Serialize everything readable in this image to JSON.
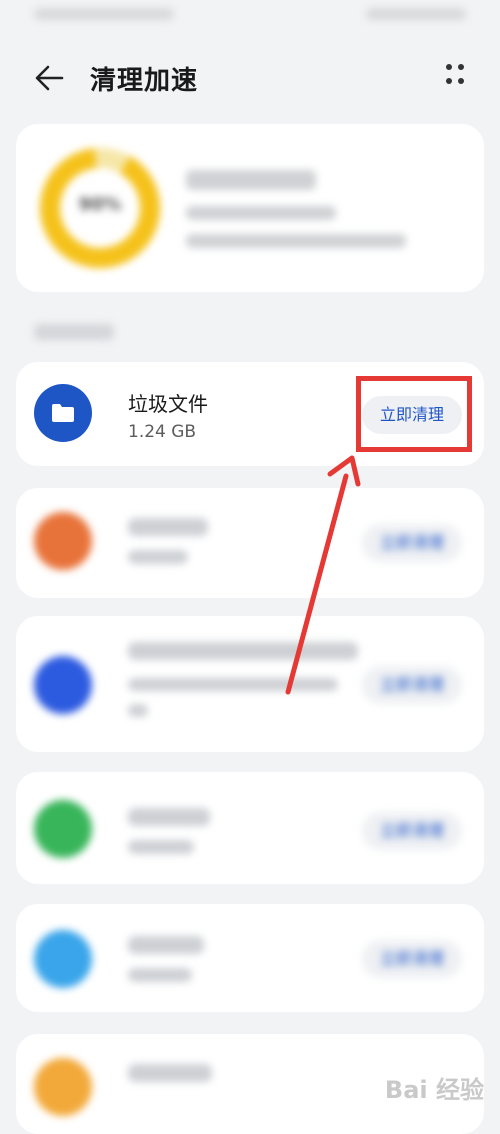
{
  "header": {
    "title": "清理加速"
  },
  "summary": {
    "ring_label": "90%",
    "ring_color": "#f5c21b",
    "ring_track": "#f6e7a8"
  },
  "items": [
    {
      "title": "垃圾文件",
      "size": "1.24 GB",
      "button": "立即清理",
      "color": "#1f56c6"
    },
    {
      "button": "立即清理",
      "color": "#e8733a"
    },
    {
      "button": "立即清理",
      "color": "#2d5be0"
    },
    {
      "button": "立即清理",
      "color": "#38b55a"
    },
    {
      "button": "立即清理",
      "color": "#3aa5ea"
    },
    {
      "color": "#f2a93a"
    }
  ],
  "watermark": {
    "text": "Bai 经验"
  }
}
